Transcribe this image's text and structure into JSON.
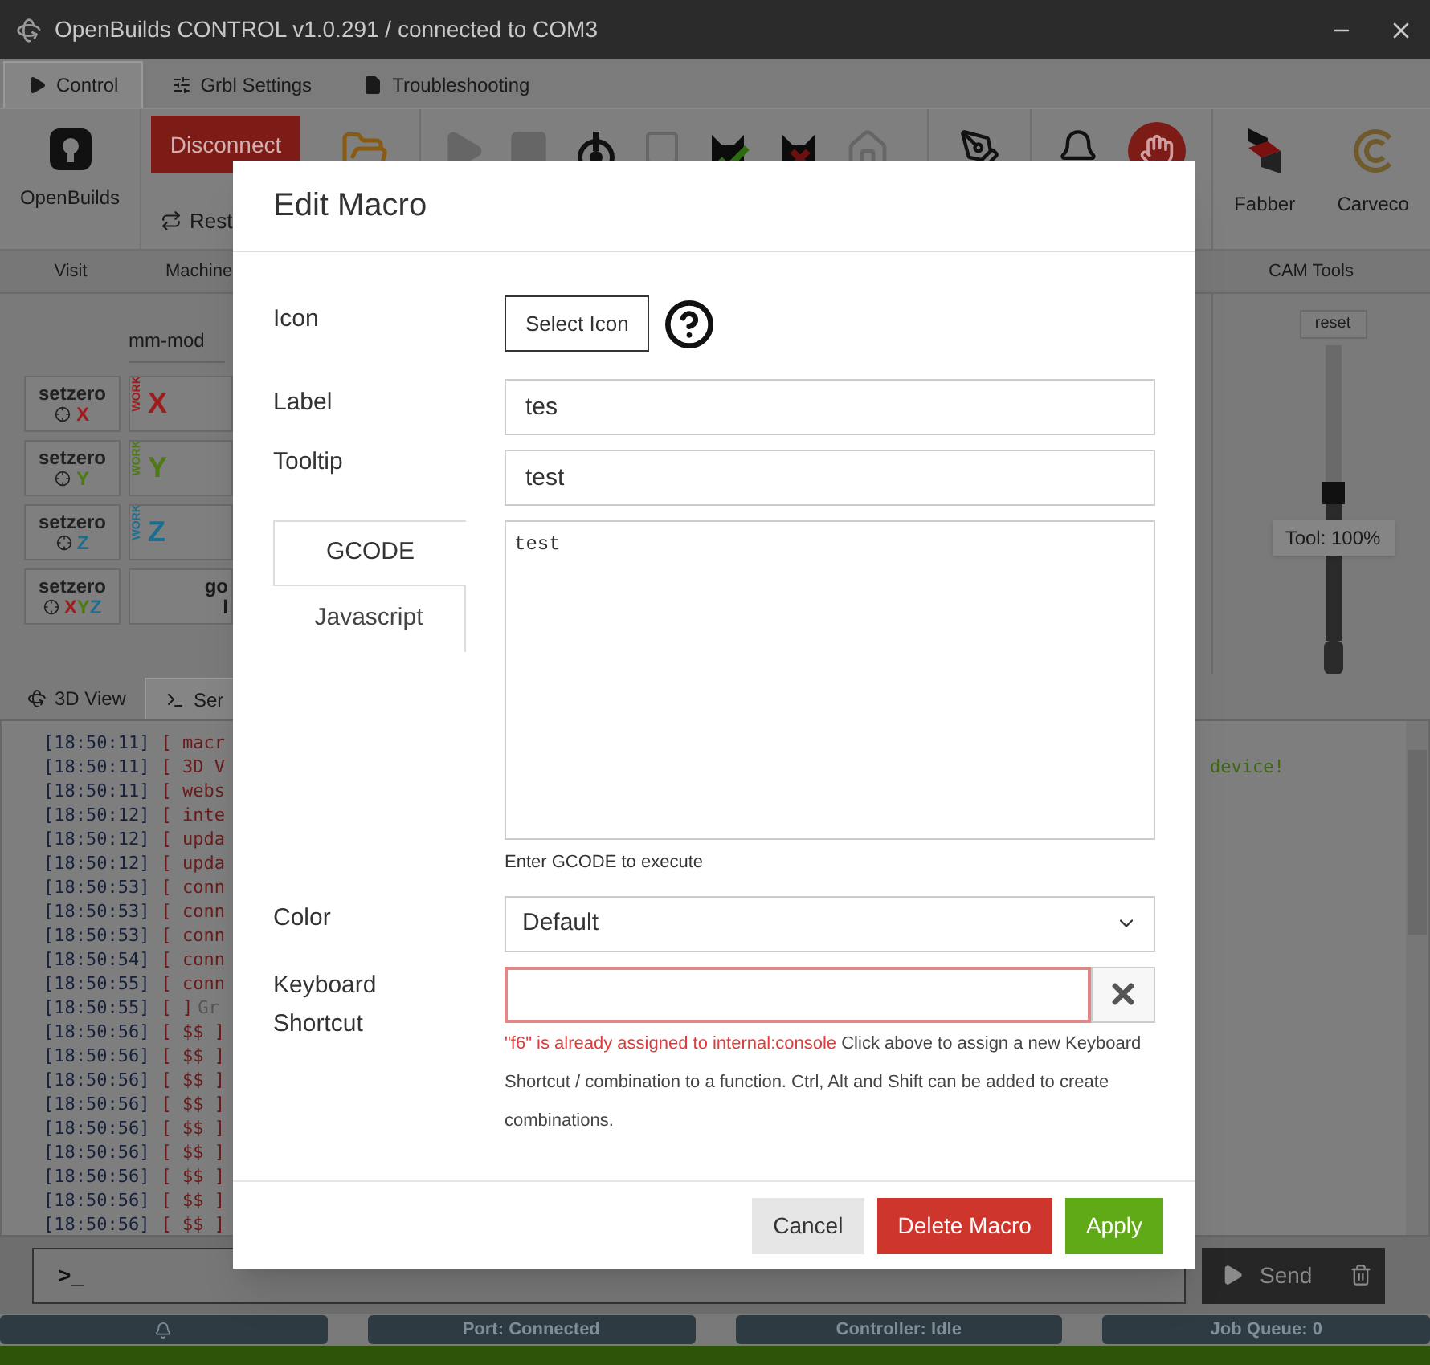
{
  "window": {
    "title": "OpenBuilds CONTROL v1.0.291 / connected to COM3"
  },
  "tabs": [
    {
      "label": "Control",
      "selected": true
    },
    {
      "label": "Grbl Settings",
      "selected": false
    },
    {
      "label": "Troubleshooting",
      "selected": false
    }
  ],
  "toolbar": {
    "logo_label": "OpenBuilds",
    "disconnect_button": "Disconnect",
    "reset_button": "Rest",
    "cam_tools": [
      "Fabber",
      "Carveco"
    ],
    "visit_label": "Visit",
    "machine_label": "Machine",
    "cam_label": "CAM Tools"
  },
  "jog": {
    "unit_select": "mm-mod",
    "setzero_buttons": [
      {
        "label": "setzero",
        "axes": [
          {
            "letter": "X",
            "color": "#a01c1c"
          }
        ]
      },
      {
        "label": "setzero",
        "axes": [
          {
            "letter": "Y",
            "color": "#4d7a12"
          }
        ]
      },
      {
        "label": "setzero",
        "axes": [
          {
            "letter": "Z",
            "color": "#1a6f91"
          }
        ]
      },
      {
        "label": "setzero",
        "axes": [
          {
            "letter": "X",
            "color": "#a01c1c"
          },
          {
            "letter": "Y",
            "color": "#4d7a12"
          },
          {
            "letter": "Z",
            "color": "#1a6f91"
          }
        ]
      }
    ],
    "work_displays": [
      {
        "tag": "WORK",
        "axis": "X",
        "color": "#a01c1c"
      },
      {
        "tag": "WORK",
        "axis": "Y",
        "color": "#4d7a12"
      },
      {
        "tag": "WORK",
        "axis": "Z",
        "color": "#1a6f91"
      }
    ],
    "goto_button": [
      "go",
      "l"
    ]
  },
  "spindle": {
    "reset_button": "reset",
    "level": 0.5,
    "tooltip": "Tool: 100%"
  },
  "view_tabs": [
    {
      "label": "3D View",
      "selected": false
    },
    {
      "label": "Ser",
      "selected": true
    }
  ],
  "console": {
    "lines": [
      {
        "time": "[18:50:11]",
        "tag": "[ macr"
      },
      {
        "time": "[18:50:11]",
        "tag": "[ 3D V"
      },
      {
        "time": "[18:50:11]",
        "tag": "[ webs"
      },
      {
        "time": "[18:50:12]",
        "tag": "[ inte"
      },
      {
        "time": "[18:50:12]",
        "tag": "[ upda"
      },
      {
        "time": "[18:50:12]",
        "tag": "[ upda"
      },
      {
        "time": "[18:50:53]",
        "tag": "[ conn"
      },
      {
        "time": "[18:50:53]",
        "tag": "[ conn"
      },
      {
        "time": "[18:50:53]",
        "tag": "[ conn"
      },
      {
        "time": "[18:50:54]",
        "tag": "[ conn"
      },
      {
        "time": "[18:50:55]",
        "tag": "[ conn"
      },
      {
        "time": "[18:50:55]",
        "tag": "[ ]",
        "text": "Gr"
      },
      {
        "time": "[18:50:56]",
        "tag": "[ $$ ]"
      },
      {
        "time": "[18:50:56]",
        "tag": "[ $$ ]"
      },
      {
        "time": "[18:50:56]",
        "tag": "[ $$ ]"
      },
      {
        "time": "[18:50:56]",
        "tag": "[ $$ ]"
      },
      {
        "time": "[18:50:56]",
        "tag": "[ $$ ]"
      },
      {
        "time": "[18:50:56]",
        "tag": "[ $$ ]"
      },
      {
        "time": "[18:50:56]",
        "tag": "[ $$ ]"
      },
      {
        "time": "[18:50:56]",
        "tag": "[ $$ ]"
      },
      {
        "time": "[18:50:56]",
        "tag": "[ $$ ]"
      }
    ],
    "right_text": "device!"
  },
  "command": {
    "prompt": ">_",
    "send_button": "Send"
  },
  "status_bar": [
    "Port: Connected",
    "Controller: Idle",
    "Job Queue: 0"
  ],
  "modal": {
    "title": "Edit Macro",
    "icon_label": "Icon",
    "select_icon_button": "Select Icon",
    "label_label": "Label",
    "label_value": "tes",
    "tooltip_label": "Tooltip",
    "tooltip_value": "test",
    "code_tabs": [
      {
        "label": "GCODE",
        "selected": true
      },
      {
        "label": "Javascript",
        "selected": false
      }
    ],
    "code": "test",
    "code_help": "Enter GCODE to execute",
    "color_label": "Color",
    "color_value": "Default",
    "shortcut_label": "Keyboard Shortcut",
    "shortcut_invalid": true,
    "shortcut_error": "\"f6\" is already assigned to internal:console",
    "shortcut_help": "Click above to assign a new Keyboard Shortcut / combination to a function. Ctrl, Alt and Shift can be added to create combinations.",
    "buttons": [
      {
        "label": "Cancel",
        "kind": "cancel"
      },
      {
        "label": "Delete Macro",
        "kind": "danger"
      },
      {
        "label": "Apply",
        "kind": "primary"
      }
    ]
  }
}
